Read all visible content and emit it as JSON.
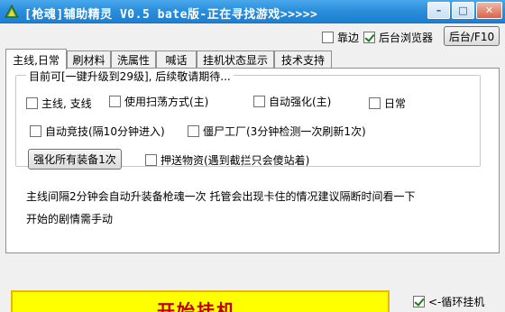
{
  "window": {
    "title": "[枪魂]辅助精灵 V0.5 bate版-正在寻找游戏>>>>>",
    "minimize_glyph": "–",
    "maximize_glyph": "□",
    "close_glyph": "✕"
  },
  "options": {
    "dock_label": "靠边",
    "dock_checked": false,
    "bg_browser_label": "后台浏览器",
    "bg_browser_checked": true,
    "bg_button_label": "后台/F10"
  },
  "tabs": [
    {
      "label": "主线,日常",
      "active": true
    },
    {
      "label": "刷材料",
      "active": false
    },
    {
      "label": "洗属性",
      "active": false
    },
    {
      "label": "喊话",
      "active": false
    },
    {
      "label": "挂机状态显示",
      "active": false
    },
    {
      "label": "技术支持",
      "active": false
    }
  ],
  "main_tab": {
    "group_title": "目前可[一键升级到29级], 后续敬请期待...",
    "checkboxes": [
      {
        "label": "主线, 支线",
        "checked": false
      },
      {
        "label": "使用扫荡方式(主)",
        "checked": false
      },
      {
        "label": "自动强化(主)",
        "checked": false
      },
      {
        "label": "日常",
        "checked": false
      },
      {
        "label": "自动竞技(隔10分钟进入)",
        "checked": false
      },
      {
        "label": "僵尸工厂(3分钟检测一次刷新1次)",
        "checked": false
      }
    ],
    "enhance_button_label": "强化所有装备1次",
    "escort_label": "押送物资(遇到截拦只会傻站着)",
    "escort_checked": false,
    "info_line1": "主线间隔2分钟会自动升装备枪魂一次 托管会出现卡住的情况建议隔断时间看一下",
    "info_line2": "开始的剧情需手动"
  },
  "footer": {
    "start_label": "开始挂机",
    "loop_label": "<-循环挂机",
    "loop_checked": true
  },
  "colors": {
    "titlebar": "#2b8fdc",
    "start_bg": "#ffff00",
    "start_text": "#c00000"
  }
}
